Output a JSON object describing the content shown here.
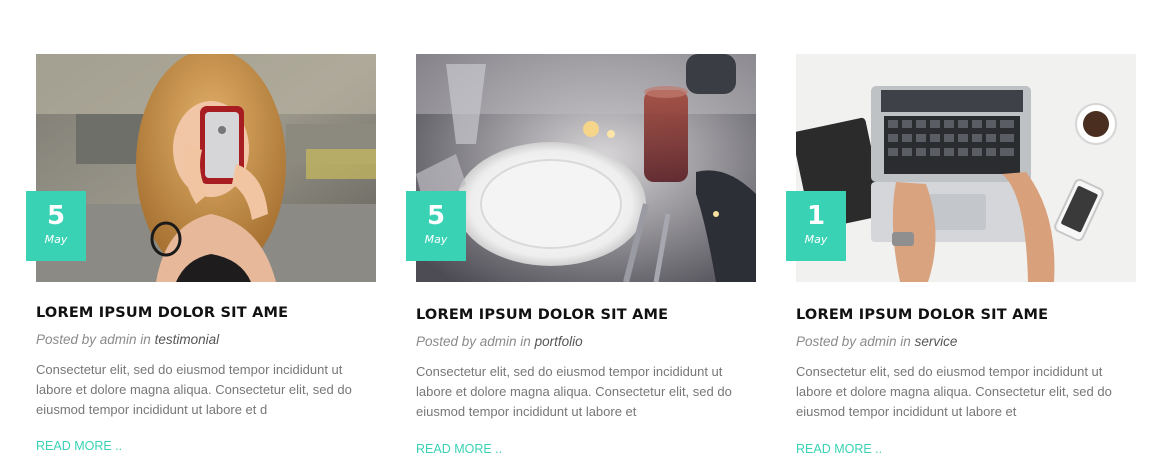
{
  "posts": [
    {
      "day": "5",
      "month": "May",
      "title": "LOREM IPSUM DOLOR SIT AME",
      "posted_by_prefix": "Posted by admin in ",
      "category": "testimonial",
      "excerpt": "Consectetur elit, sed do eiusmod tempor incididunt ut labore et dolore magna aliqua. Consectetur elit, sed do eiusmod tempor incididunt ut labore et d",
      "read_more": "READ MORE .."
    },
    {
      "day": "5",
      "month": "May",
      "title": "LOREM IPSUM DOLOR SIT AME",
      "posted_by_prefix": "Posted by admin in ",
      "category": "portfolio",
      "excerpt": "Consectetur elit, sed do eiusmod tempor incididunt ut labore et dolore magna aliqua. Consectetur elit, sed do eiusmod tempor incididunt ut labore et",
      "read_more": "READ MORE .."
    },
    {
      "day": "1",
      "month": "May",
      "title": "LOREM IPSUM DOLOR SIT AME",
      "posted_by_prefix": "Posted by admin in ",
      "category": "service",
      "excerpt": "Consectetur elit, sed do eiusmod tempor incididunt ut labore et dolore magna aliqua. Consectetur elit, sed do eiusmod tempor incididunt ut labore et",
      "read_more": "READ MORE .."
    }
  ],
  "colors": {
    "accent": "#3ad2b5",
    "title": "#111111",
    "meta": "#8a8a8a",
    "body_text": "#777777"
  }
}
